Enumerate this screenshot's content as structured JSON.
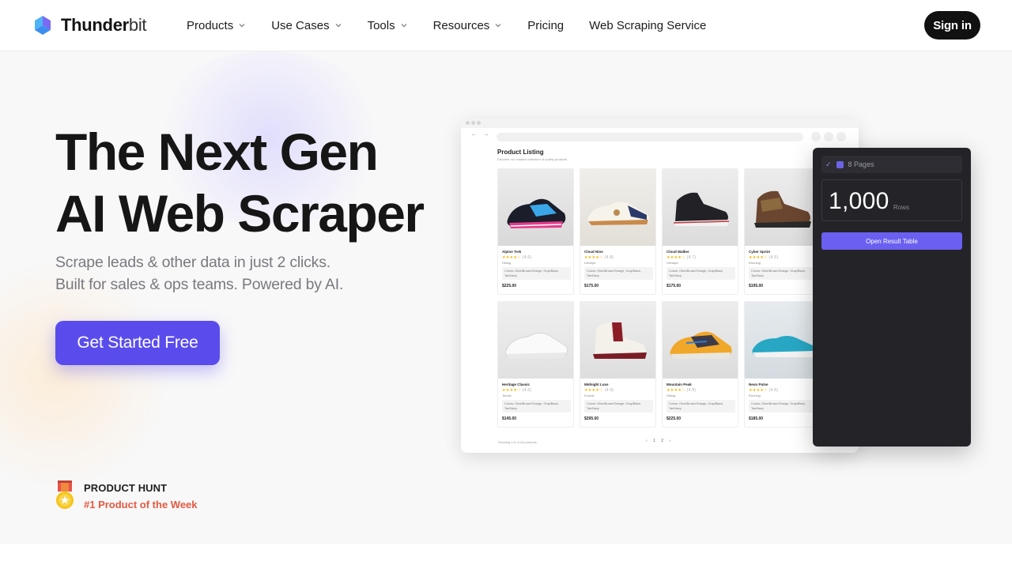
{
  "header": {
    "brand_bold": "Thunder",
    "brand_light": "bit",
    "nav": [
      {
        "label": "Products",
        "dropdown": true
      },
      {
        "label": "Use Cases",
        "dropdown": true
      },
      {
        "label": "Tools",
        "dropdown": true
      },
      {
        "label": "Resources",
        "dropdown": true
      },
      {
        "label": "Pricing",
        "dropdown": false
      },
      {
        "label": "Web Scraping Service",
        "dropdown": false
      }
    ],
    "signin_label": "Sign in"
  },
  "hero": {
    "headline_line1": "The Next Gen",
    "headline_line2": "AI Web Scraper",
    "sub_line1": "Scrape leads & other data in just 2 clicks.",
    "sub_line2": "Built for sales & ops teams. Powered by AI.",
    "cta_label": "Get Started Free"
  },
  "badge": {
    "title": "PRODUCT HUNT",
    "subtitle": "#1 Product of the Week"
  },
  "mockup": {
    "listing_title": "Product Listing",
    "listing_desc": "Discover our curated collection of quality products",
    "products": [
      {
        "name": "Alpine Trek",
        "category": "Hiking",
        "price": "$225.00",
        "rating": "(4.6)",
        "colors": "Colors: Olive/Brown/Orange, Gray/Black, Tan/Navy"
      },
      {
        "name": "Cloud Nine",
        "category": "Lifestyle",
        "price": "$175.00",
        "rating": "(4.8)",
        "colors": "Colors: Olive/Brown/Orange, Gray/Black, Tan/Navy"
      },
      {
        "name": "Cloud Walker",
        "category": "Lifestyle",
        "price": "$175.00",
        "rating": "(4.7)",
        "colors": "Colors: Olive/Brown/Orange, Gray/Black, Tan/Navy"
      },
      {
        "name": "Cyber Sprint",
        "category": "Running",
        "price": "$195.00",
        "rating": "(4.5)",
        "colors": "Colors: Olive/Brown/Orange, Gray/Black, Tan/Navy"
      },
      {
        "name": "Heritage Classic",
        "category": "Tennis",
        "price": "$145.00",
        "rating": "(4.6)",
        "colors": "Colors: Olive/Brown/Orange, Gray/Black, Tan/Navy"
      },
      {
        "name": "Midnight Luxe",
        "category": "Formal",
        "price": "$295.00",
        "rating": "(4.9)",
        "colors": "Colors: Olive/Brown/Orange, Gray/Black, Tan/Navy"
      },
      {
        "name": "Mountain Peak",
        "category": "Hiking",
        "price": "$225.00",
        "rating": "(4.8)",
        "colors": "Colors: Olive/Brown/Orange, Gray/Black, Tan/Navy"
      },
      {
        "name": "Neon Pulse",
        "category": "Running",
        "price": "$185.00",
        "rating": "(4.6)",
        "colors": "Colors: Olive/Brown/Orange, Gray/Black, Tan/Navy"
      }
    ],
    "footer_note": "Showing 1-8 of 16 products",
    "pages": [
      "1",
      "2"
    ]
  },
  "panel": {
    "pages_label": "8 Pages",
    "rows_value": "1,000",
    "rows_label": "Rows",
    "open_label": "Open Result Table"
  },
  "colors": {
    "accent": "#5a4cec",
    "badge_red": "#e4593f",
    "panel_bg": "#232328"
  }
}
